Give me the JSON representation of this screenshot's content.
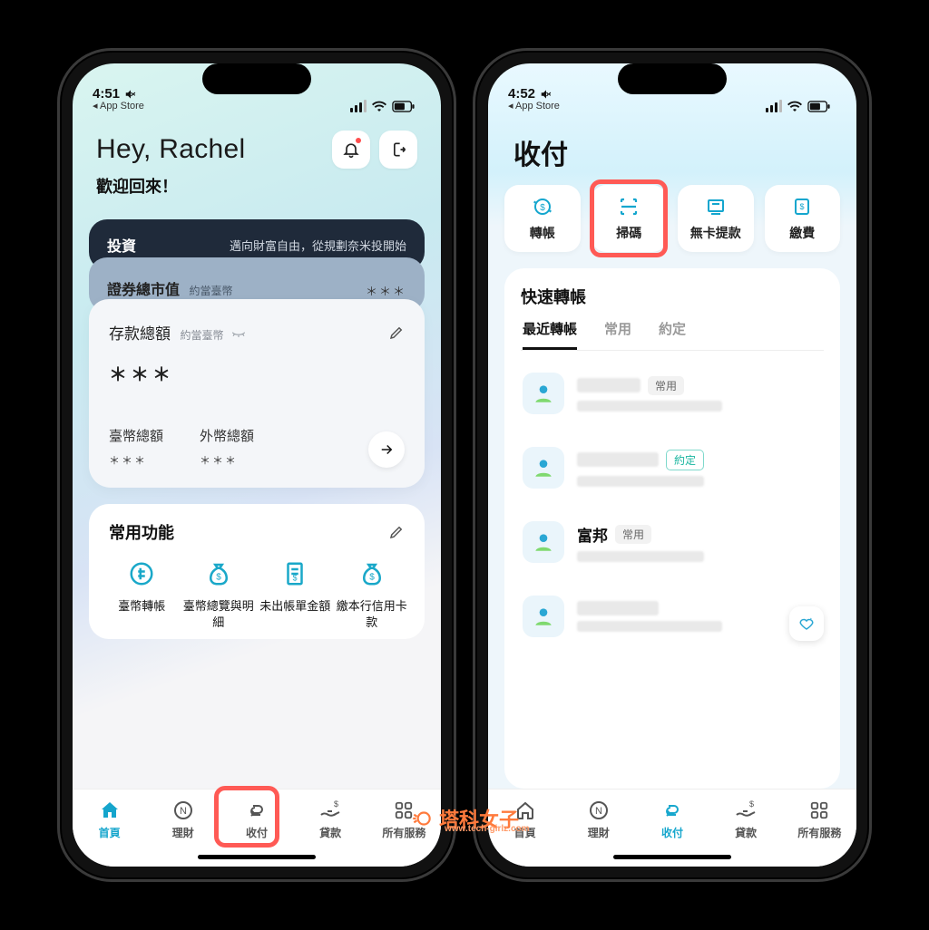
{
  "status": {
    "time_left": "4:51",
    "time_right": "4:52",
    "back": "App Store"
  },
  "left": {
    "greeting": "Hey, Rachel",
    "welcome": "歡迎回來！",
    "cards": {
      "invest_label": "投資",
      "invest_tagline": "邁向財富自由，從規劃奈米投開始",
      "securities_label": "證券總市值",
      "securities_sub": "約當臺幣",
      "securities_mask": "＊＊＊",
      "deposit_label": "存款總額",
      "deposit_sub": "約當臺幣",
      "deposit_mask": "＊＊＊",
      "twd_label": "臺幣總額",
      "twd_mask": "＊＊＊",
      "fx_label": "外幣總額",
      "fx_mask": "＊＊＊"
    },
    "quick": {
      "title": "常用功能",
      "items": [
        "臺幣轉帳",
        "臺幣總覽與明細",
        "未出帳單金額",
        "繳本行信用卡款"
      ]
    }
  },
  "bottom_nav": [
    "首頁",
    "理財",
    "收付",
    "貸款",
    "所有服務"
  ],
  "right": {
    "title": "收付",
    "actions": [
      "轉帳",
      "掃碼",
      "無卡提款",
      "繳費"
    ],
    "quick_transfer_title": "快速轉帳",
    "tabs": [
      "最近轉帳",
      "常用",
      "約定"
    ],
    "rows": {
      "chip_common": "常用",
      "chip_contract": "約定",
      "row3_name": "富邦"
    }
  },
  "watermark": {
    "text": "塔科女子",
    "url": "www.tech-girlz.com"
  }
}
